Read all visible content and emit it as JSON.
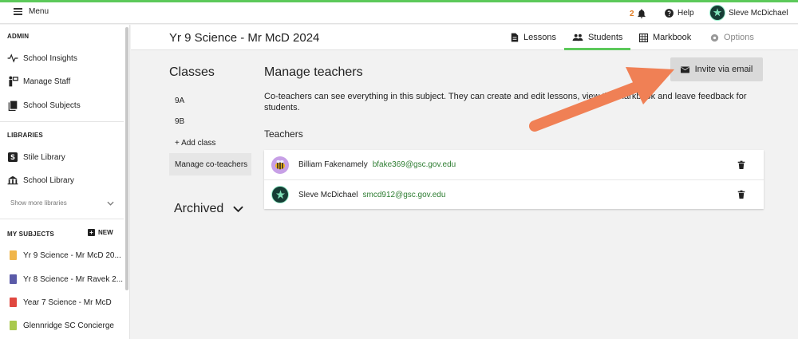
{
  "topbar": {
    "menu_label": "Menu",
    "notifications_count": "2",
    "help_label": "Help",
    "user_name": "Sleve McDichael"
  },
  "sidebar": {
    "admin_heading": "ADMIN",
    "admin_items": [
      {
        "label": "School Insights",
        "icon": "pulse-icon"
      },
      {
        "label": "Manage Staff",
        "icon": "staff-icon"
      },
      {
        "label": "School Subjects",
        "icon": "books-icon"
      }
    ],
    "libraries_heading": "LIBRARIES",
    "library_items": [
      {
        "label": "Stile Library",
        "icon": "stile-logo-icon"
      },
      {
        "label": "School Library",
        "icon": "school-building-icon"
      }
    ],
    "show_more_label": "Show more libraries",
    "my_subjects_heading": "MY SUBJECTS",
    "new_label": "NEW",
    "subjects": [
      {
        "label": "Yr 9 Science - Mr McD 20...",
        "color": "#f0b54a"
      },
      {
        "label": "Yr 8 Science - Mr Ravek 2...",
        "color": "#5a5aa8"
      },
      {
        "label": "Year 7 Science - Mr McD",
        "color": "#e0473f"
      },
      {
        "label": "Glennridge SC Concierge",
        "color": "#a9c94d"
      }
    ]
  },
  "subject_header": {
    "title": "Yr 9 Science - Mr McD 2024",
    "tabs": [
      {
        "label": "Lessons",
        "icon": "document-icon"
      },
      {
        "label": "Students",
        "icon": "people-icon"
      },
      {
        "label": "Markbook",
        "icon": "grid-icon"
      },
      {
        "label": "Options",
        "icon": "gear-icon"
      }
    ]
  },
  "classes": {
    "title": "Classes",
    "items": [
      "9A",
      "9B"
    ],
    "add_label": "+ Add class",
    "manage_label": "Manage co-teachers",
    "archived_label": "Archived"
  },
  "manage": {
    "title": "Manage teachers",
    "invite_label": "Invite via email",
    "description": "Co-teachers can see everything in this subject. They can create and edit lessons, view the markbook and leave feedback for students.",
    "teachers_heading": "Teachers",
    "teachers": [
      {
        "name": "Billiam Fakenamely",
        "email": "bfake369@gsc.gov.edu"
      },
      {
        "name": "Sleve McDichael",
        "email": "smcd912@gsc.gov.edu"
      }
    ]
  },
  "colors": {
    "accent_green": "#5cc95a",
    "email_green": "#2e7d32",
    "arrow_orange": "#f08055",
    "notif_orange": "#e07a1f"
  }
}
